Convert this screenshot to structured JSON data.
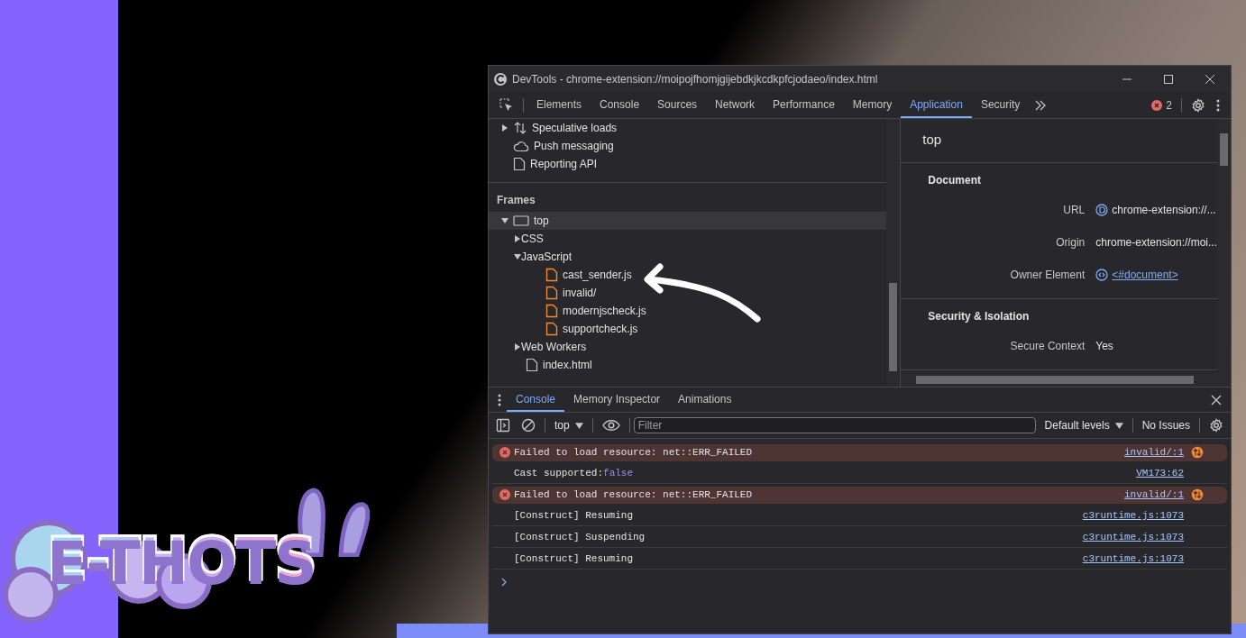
{
  "desktop": {
    "logo": "E-THOTS"
  },
  "window": {
    "title": "DevTools - chrome-extension://moipojfhomjgijebdkjkcdkpfcjodaeo/index.html"
  },
  "toolbar": {
    "tabs": [
      {
        "label": "Elements",
        "selected": false
      },
      {
        "label": "Console",
        "selected": false
      },
      {
        "label": "Sources",
        "selected": false
      },
      {
        "label": "Network",
        "selected": false
      },
      {
        "label": "Performance",
        "selected": false
      },
      {
        "label": "Memory",
        "selected": false
      },
      {
        "label": "Application",
        "selected": true
      },
      {
        "label": "Security",
        "selected": false
      }
    ],
    "error_count": "2"
  },
  "sidebar": {
    "items": [
      {
        "label": "Speculative loads",
        "kind": "arrows",
        "expanded": false,
        "selected": false
      },
      {
        "label": "Push messaging",
        "kind": "cloud",
        "selected": false
      },
      {
        "label": "Reporting API",
        "kind": "document",
        "selected": false
      }
    ],
    "frames": {
      "heading": "Frames",
      "tree": [
        {
          "label": "top",
          "kind": "frame",
          "expanded": true,
          "selected": true,
          "children": [
            {
              "label": "CSS",
              "kind": "group",
              "expanded": false,
              "selected": false
            },
            {
              "label": "JavaScript",
              "kind": "group",
              "expanded": true,
              "selected": false,
              "children": [
                {
                  "label": "cast_sender.js",
                  "kind": "script",
                  "selected": false
                },
                {
                  "label": "invalid/",
                  "kind": "script",
                  "selected": false
                },
                {
                  "label": "modernjscheck.js",
                  "kind": "script",
                  "selected": false
                },
                {
                  "label": "supportcheck.js",
                  "kind": "script",
                  "selected": false
                }
              ]
            },
            {
              "label": "Web Workers",
              "kind": "group",
              "expanded": false,
              "selected": false
            },
            {
              "label": "index.html",
              "kind": "document",
              "selected": false
            }
          ]
        }
      ]
    }
  },
  "details": {
    "title": "top",
    "sections": [
      {
        "heading": "Document",
        "rows": [
          {
            "label": "URL",
            "value": "chrome-extension://...",
            "kind": "frame-link"
          },
          {
            "label": "Origin",
            "value": "chrome-extension://moi...",
            "kind": "text"
          },
          {
            "label": "Owner Element",
            "value": "<#document>",
            "kind": "node-link"
          }
        ]
      },
      {
        "heading": "Security & Isolation",
        "rows": [
          {
            "label": "Secure Context",
            "value": "Yes",
            "kind": "text"
          }
        ]
      }
    ]
  },
  "drawer": {
    "tabs": [
      {
        "label": "Console",
        "selected": true
      },
      {
        "label": "Memory Inspector",
        "selected": false
      },
      {
        "label": "Animations",
        "selected": false
      }
    ],
    "context": "top",
    "filter": {
      "placeholder": "Filter"
    },
    "levels": "Default levels",
    "issues": "No Issues",
    "messages": [
      {
        "kind": "error",
        "text": "Failed to load resource: net::ERR_FAILED",
        "source": "invalid/:1"
      },
      {
        "kind": "log",
        "text": "Cast supported: ",
        "value": "false",
        "source": "VM173:62"
      },
      {
        "kind": "error",
        "text": "Failed to load resource: net::ERR_FAILED",
        "source": "invalid/:1"
      },
      {
        "kind": "log",
        "text": "[Construct] Resuming",
        "source": "c3runtime.js:1073"
      },
      {
        "kind": "log",
        "text": "[Construct] Suspending",
        "source": "c3runtime.js:1073"
      },
      {
        "kind": "log",
        "text": "[Construct] Resuming",
        "source": "c3runtime.js:1073"
      }
    ]
  }
}
